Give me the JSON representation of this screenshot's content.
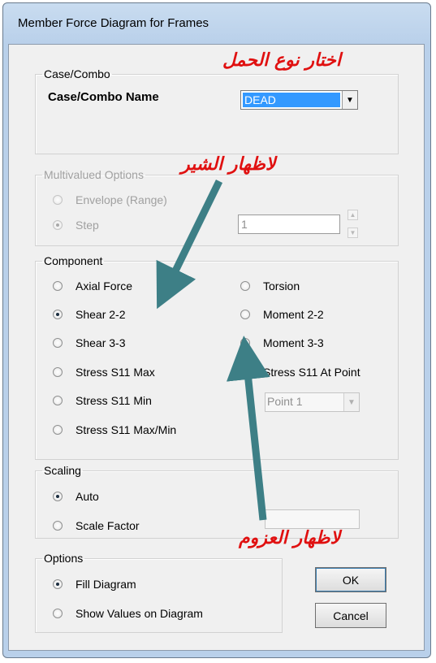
{
  "window": {
    "title": "Member Force Diagram for Frames"
  },
  "case_combo": {
    "legend": "Case/Combo",
    "label": "Case/Combo Name",
    "selected": "DEAD"
  },
  "multivalued": {
    "legend": "Multivalued Options",
    "envelope": "Envelope (Range)",
    "step": "Step",
    "step_value": "1"
  },
  "component": {
    "legend": "Component",
    "left": [
      "Axial Force",
      "Shear 2-2",
      "Shear 3-3",
      "Stress S11 Max",
      "Stress S11 Min",
      "Stress S11 Max/Min"
    ],
    "right": [
      "Torsion",
      "Moment 2-2",
      "Moment 3-3",
      "Stress S11 At Point"
    ],
    "point_select": "Point 1"
  },
  "scaling": {
    "legend": "Scaling",
    "auto": "Auto",
    "scale_factor": "Scale Factor"
  },
  "options": {
    "legend": "Options",
    "fill": "Fill Diagram",
    "show_values": "Show Values on Diagram"
  },
  "buttons": {
    "ok": "OK",
    "cancel": "Cancel"
  },
  "annotations": {
    "load_type": "اختار نوع الحمل",
    "show_shear": "لاظهار الشير",
    "show_moments": "لاظهار العزوم"
  },
  "colors": {
    "annotation_text": "#e01010",
    "arrow": "#3d7f86"
  }
}
